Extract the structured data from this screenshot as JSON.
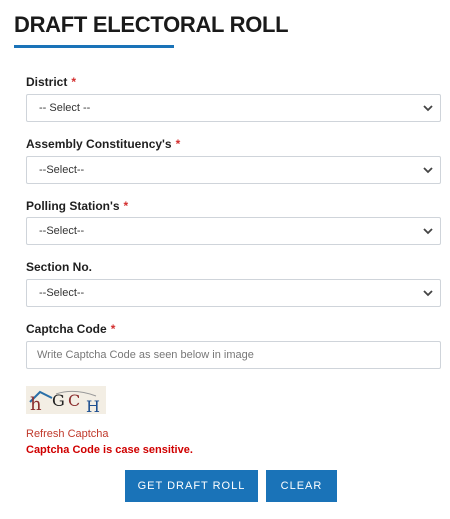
{
  "page_title": "DRAFT ELECTORAL ROLL",
  "required_mark": "*",
  "fields": {
    "district": {
      "label": "District",
      "value": "-- Select --"
    },
    "assembly": {
      "label": "Assembly Constituency's",
      "value": "--Select--"
    },
    "polling": {
      "label": "Polling Station's",
      "value": "--Select--"
    },
    "section": {
      "label": "Section No.",
      "value": "--Select--"
    },
    "captcha": {
      "label": "Captcha Code",
      "placeholder": "Write Captcha Code as seen below in image"
    }
  },
  "captcha_image_text": "hGCH",
  "refresh_label": "Refresh Captcha",
  "case_hint": "Captcha Code is case sensitive.",
  "buttons": {
    "submit": "GET DRAFT ROLL",
    "clear": "CLEAR"
  },
  "colors": {
    "accent": "#1a73b8",
    "required": "#d32f2f",
    "hint": "#d00000"
  }
}
